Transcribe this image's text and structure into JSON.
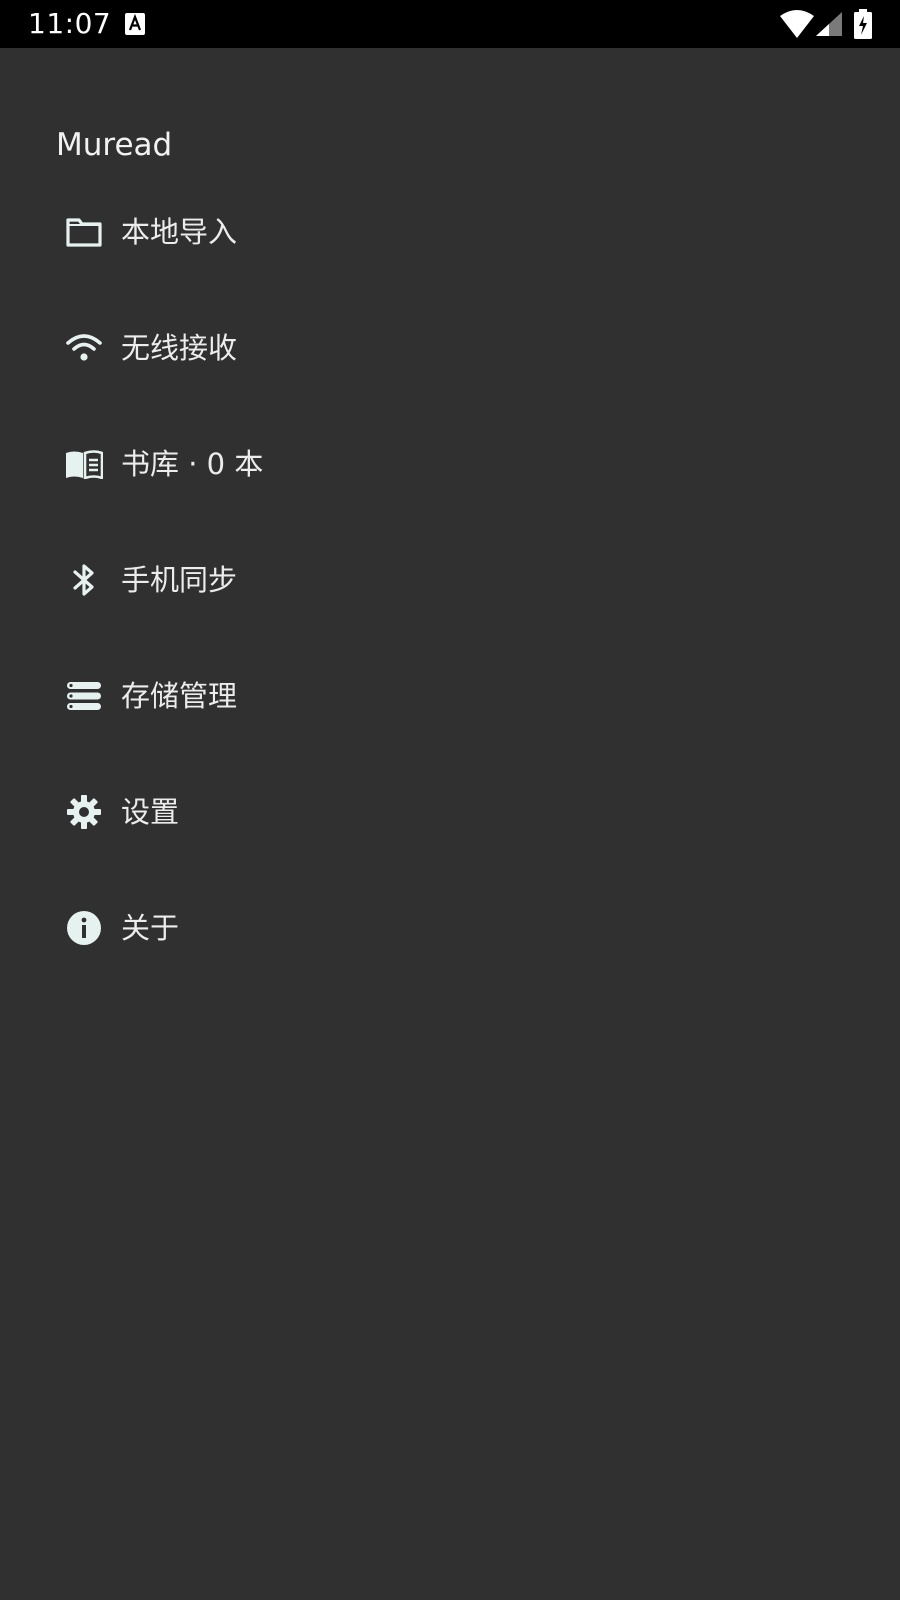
{
  "status_bar": {
    "time": "11:07",
    "icons": [
      "a-notification-icon",
      "wifi-icon",
      "signal-icon",
      "battery-charging-icon"
    ]
  },
  "drawer": {
    "app_title": "Muread",
    "items": [
      {
        "label": "本地导入",
        "icon": "folder-icon"
      },
      {
        "label": "无线接收",
        "icon": "wifi-icon"
      },
      {
        "label": "书库 · 0 本",
        "icon": "book-icon"
      },
      {
        "label": "手机同步",
        "icon": "bluetooth-icon"
      },
      {
        "label": "存储管理",
        "icon": "storage-icon"
      },
      {
        "label": "设置",
        "icon": "gear-icon"
      },
      {
        "label": "关于",
        "icon": "info-icon"
      }
    ]
  },
  "colors": {
    "background": "#303030",
    "status_bar": "#000000",
    "text": "#ececec",
    "icon": "#e6f2ef"
  }
}
